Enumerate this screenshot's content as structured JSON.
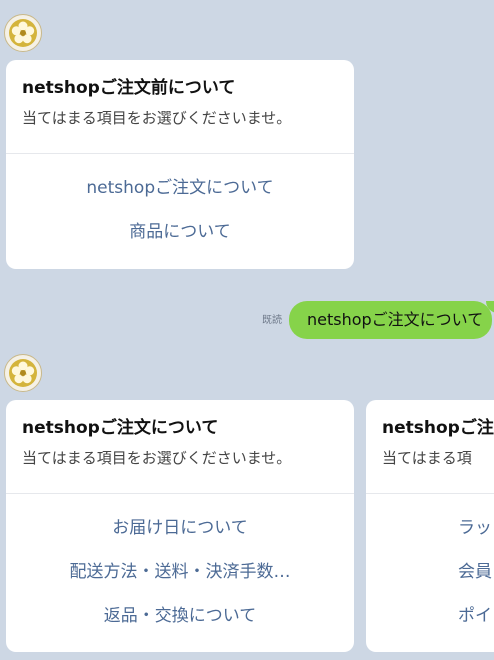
{
  "colors": {
    "background": "#cdd7e4",
    "bubble": "#86d34a",
    "action_text": "#4c6a95"
  },
  "avatar_icon": "gold-flower-crest",
  "card1": {
    "title": "netshopご注文前について",
    "subtitle": "当てはまる項目をお選びくださいませ。",
    "actions": [
      "netshopご注文について",
      "商品について"
    ]
  },
  "sent_message": {
    "text": "netshopご注文について",
    "read_label": "既読"
  },
  "card2": {
    "title": "netshopご注文について",
    "subtitle": "当てはまる項目をお選びくださいませ。",
    "actions": [
      "お届け日について",
      "配送方法・送料・決済手数…",
      "返品・交換について"
    ]
  },
  "card3": {
    "title": "netshopご注",
    "subtitle": "当てはまる項",
    "actions": [
      "ラッ",
      "会員",
      "ポイ"
    ]
  }
}
